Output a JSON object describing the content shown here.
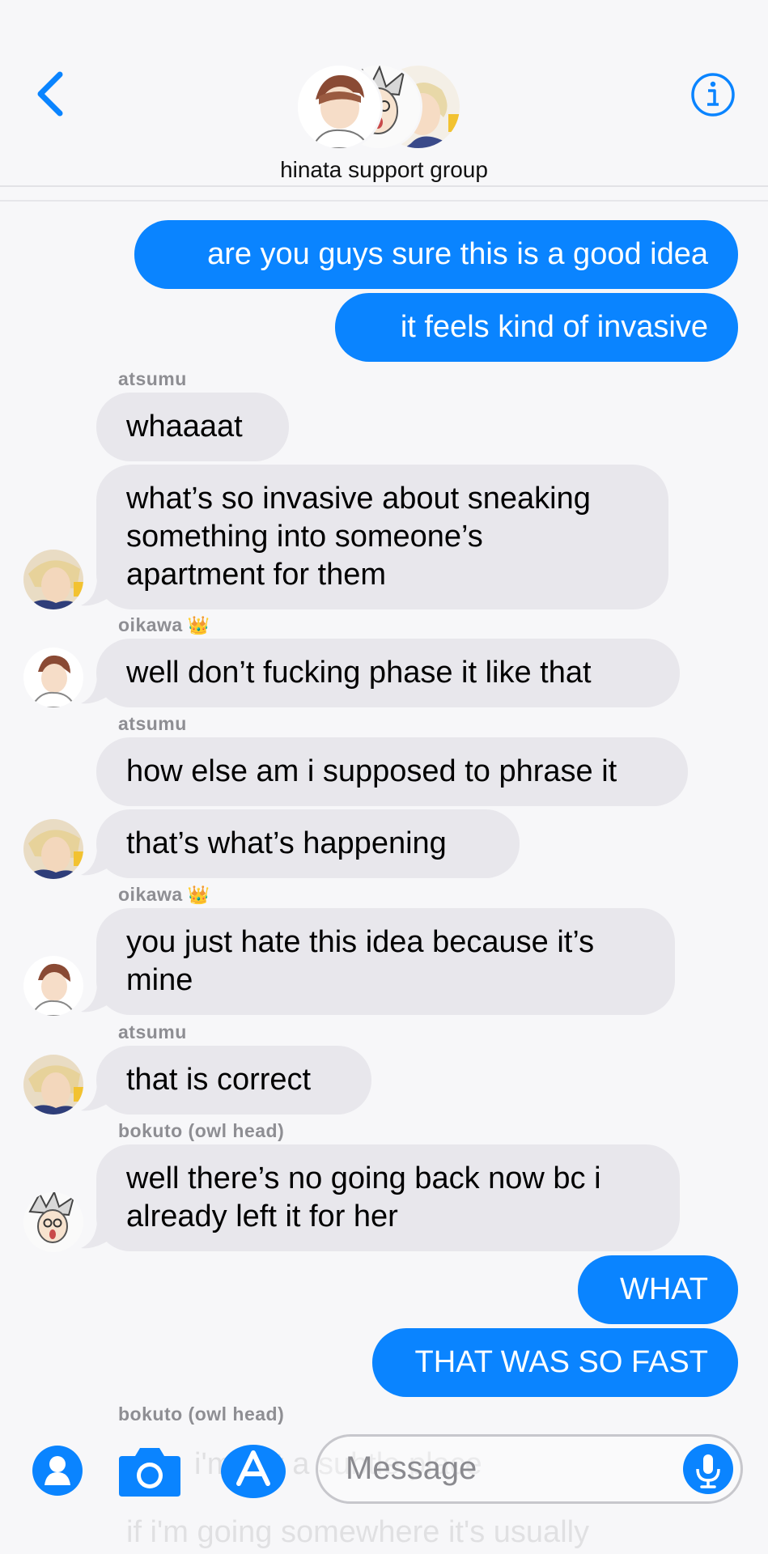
{
  "header": {
    "group_name": "hinata support group",
    "accent": "#0a84ff"
  },
  "messages": [
    {
      "id": "m1",
      "text": "are you guys sure this is a good idea",
      "direction": "out"
    },
    {
      "id": "m2",
      "text": "it feels kind of invasive",
      "direction": "out"
    },
    {
      "id": "m3",
      "sender": "atsumu",
      "text": "whaaaat",
      "direction": "in"
    },
    {
      "id": "m4",
      "text_lines": [
        "what’s so invasive about sneaking",
        "something into someone’s",
        "apartment for them"
      ],
      "direction": "in"
    },
    {
      "id": "m5",
      "sender": "oikawa",
      "sender_emoji": "👑",
      "text": "well don’t fucking phase it like that",
      "direction": "in"
    },
    {
      "id": "m6",
      "sender": "atsumu",
      "text": "how else am i supposed to phrase it",
      "direction": "in"
    },
    {
      "id": "m7",
      "text": "that’s what’s happening",
      "direction": "in"
    },
    {
      "id": "m8",
      "sender": "oikawa",
      "sender_emoji": "👑",
      "text_lines": [
        "you just hate this idea because it’s",
        "mine"
      ],
      "direction": "in"
    },
    {
      "id": "m9",
      "sender": "atsumu",
      "text": "that is correct",
      "direction": "in"
    },
    {
      "id": "m10",
      "sender": "bokuto (owl head)",
      "text_lines": [
        "well there’s no going back now bc i",
        "already left it for her"
      ],
      "direction": "in"
    },
    {
      "id": "m11",
      "text": "WHAT",
      "direction": "out"
    },
    {
      "id": "m12",
      "text": "THAT WAS SO FAST",
      "direction": "out"
    },
    {
      "id": "m13",
      "sender": "bokuto (owl head)",
      "ghost_text": "i'm not a subtle place",
      "direction": "in"
    },
    {
      "id": "m14",
      "ghost_text": "if i'm going somewhere it's usually",
      "direction": "in"
    }
  ],
  "composer": {
    "placeholder": "Message"
  }
}
